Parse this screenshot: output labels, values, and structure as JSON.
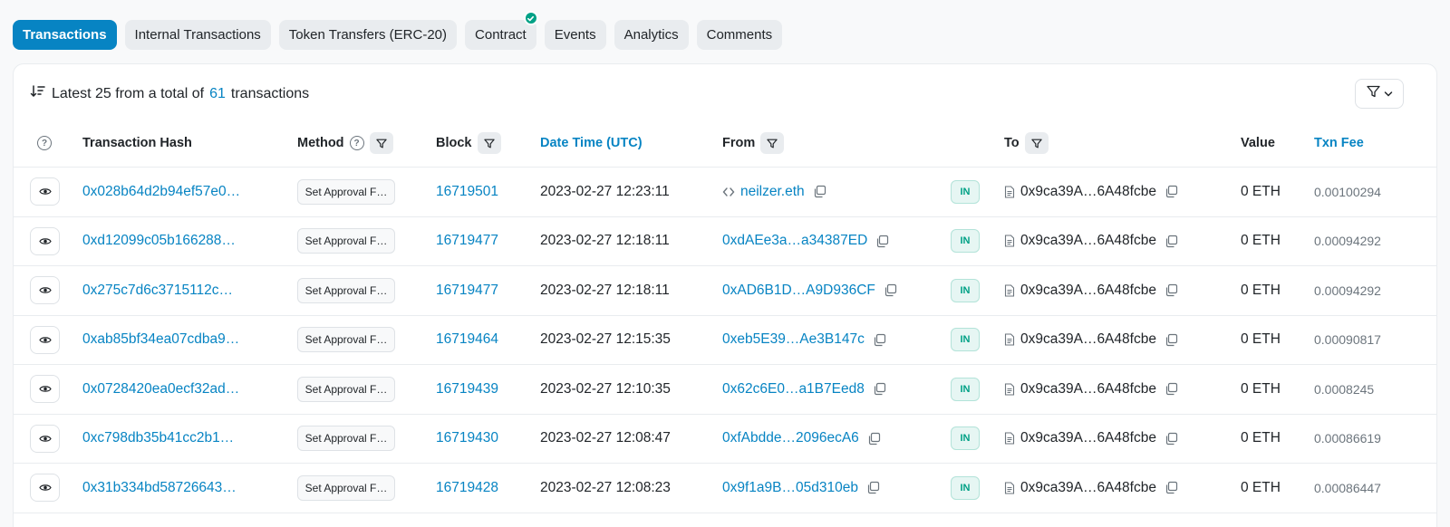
{
  "tabs": [
    {
      "label": "Transactions",
      "active": true
    },
    {
      "label": "Internal Transactions"
    },
    {
      "label": "Token Transfers (ERC-20)"
    },
    {
      "label": "Contract",
      "verified": true
    },
    {
      "label": "Events"
    },
    {
      "label": "Analytics"
    },
    {
      "label": "Comments"
    }
  ],
  "summary": {
    "prefix": "Latest 25 from a total of",
    "count": "61",
    "suffix": "transactions"
  },
  "columns": {
    "hash": "Transaction Hash",
    "method": "Method",
    "block": "Block",
    "datetime": "Date Time (UTC)",
    "from": "From",
    "to": "To",
    "value": "Value",
    "fee": "Txn Fee"
  },
  "rows": [
    {
      "hash": "0x028b64d2b94ef57e0…",
      "method": "Set Approval F…",
      "block": "16719501",
      "datetime": "2023-02-27 12:23:11",
      "from": "neilzer.eth",
      "direction": "IN",
      "to": "0x9ca39A…6A48fcbe",
      "value": "0 ETH",
      "fee": "0.00100294"
    },
    {
      "hash": "0xd12099c05b166288…",
      "method": "Set Approval F…",
      "block": "16719477",
      "datetime": "2023-02-27 12:18:11",
      "from": "0xdAEe3a…a34387ED",
      "direction": "IN",
      "to": "0x9ca39A…6A48fcbe",
      "value": "0 ETH",
      "fee": "0.00094292"
    },
    {
      "hash": "0x275c7d6c3715112c…",
      "method": "Set Approval F…",
      "block": "16719477",
      "datetime": "2023-02-27 12:18:11",
      "from": "0xAD6B1D…A9D936CF",
      "direction": "IN",
      "to": "0x9ca39A…6A48fcbe",
      "value": "0 ETH",
      "fee": "0.00094292"
    },
    {
      "hash": "0xab85bf34ea07cdba9…",
      "method": "Set Approval F…",
      "block": "16719464",
      "datetime": "2023-02-27 12:15:35",
      "from": "0xeb5E39…Ae3B147c",
      "direction": "IN",
      "to": "0x9ca39A…6A48fcbe",
      "value": "0 ETH",
      "fee": "0.00090817"
    },
    {
      "hash": "0x0728420ea0ecf32ad…",
      "method": "Set Approval F…",
      "block": "16719439",
      "datetime": "2023-02-27 12:10:35",
      "from": "0x62c6E0…a1B7Eed8",
      "direction": "IN",
      "to": "0x9ca39A…6A48fcbe",
      "value": "0 ETH",
      "fee": "0.0008245"
    },
    {
      "hash": "0xc798db35b41cc2b1…",
      "method": "Set Approval F…",
      "block": "16719430",
      "datetime": "2023-02-27 12:08:47",
      "from": "0xfAbdde…2096ecA6",
      "direction": "IN",
      "to": "0x9ca39A…6A48fcbe",
      "value": "0 ETH",
      "fee": "0.00086619"
    },
    {
      "hash": "0x31b334bd58726643…",
      "method": "Set Approval F…",
      "block": "16719428",
      "datetime": "2023-02-27 12:08:23",
      "from": "0x9f1a9B…05d310eb",
      "direction": "IN",
      "to": "0x9ca39A…6A48fcbe",
      "value": "0 ETH",
      "fee": "0.00086447"
    }
  ]
}
